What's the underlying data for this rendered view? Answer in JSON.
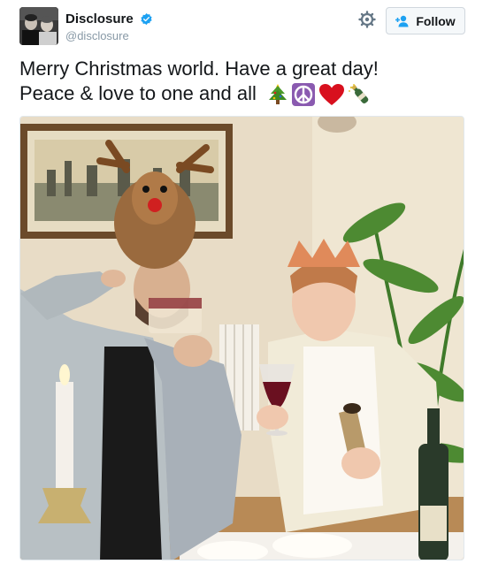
{
  "user": {
    "display_name": "Disclosure",
    "handle": "@disclosure",
    "verified": true
  },
  "actions": {
    "follow_label": "Follow",
    "follow_icon": "add-user-icon",
    "settings_icon": "gear-icon"
  },
  "tweet": {
    "line1": "Merry Christmas world. Have a great day!",
    "line2": "Peace & love to one and all",
    "emojis": [
      "christmas-tree-icon",
      "peace-symbol-icon",
      "red-heart-icon",
      "champagne-bottle-icon"
    ]
  },
  "colors": {
    "verified_blue": "#1da1f2",
    "text_primary": "#14171a",
    "text_secondary": "#8899a6",
    "button_bg": "#f5f8fa"
  }
}
